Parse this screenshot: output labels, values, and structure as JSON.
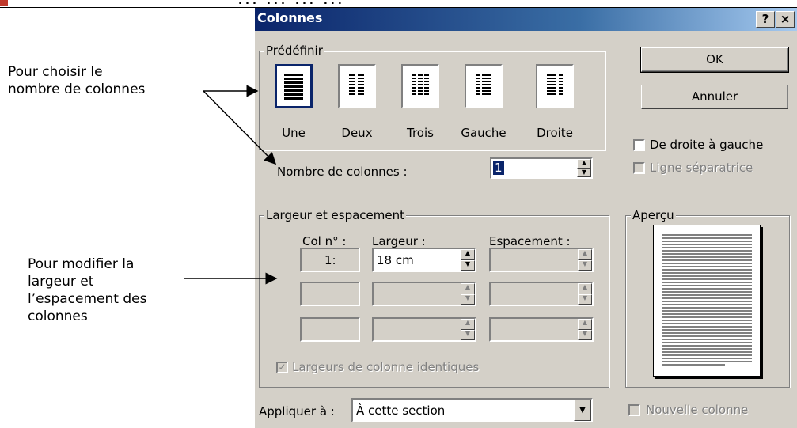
{
  "page_header_fragment": "... ... ... ...",
  "callouts": {
    "top": [
      "Pour choisir le",
      "nombre de colonnes"
    ],
    "bottom": [
      "Pour modifier la",
      "largeur et",
      "l’espacement des",
      "colonnes"
    ]
  },
  "dialog": {
    "title": "Colonnes",
    "help_button": "?",
    "close_button": "×",
    "predefinir": {
      "group_label": "Prédéfinir",
      "presets": [
        {
          "label": "Une",
          "mnemonic": "U",
          "selected": true
        },
        {
          "label": "Deux",
          "mnemonic": "x",
          "selected": false
        },
        {
          "label": "Trois",
          "mnemonic": "T",
          "selected": false
        },
        {
          "label": "Gauche",
          "mnemonic": "G",
          "selected": false
        },
        {
          "label": "Droite",
          "mnemonic": "D",
          "selected": false
        }
      ]
    },
    "ok_label": "OK",
    "cancel_label": "Annuler",
    "rtl_label": "De droite à gauche",
    "separator_label": "Ligne séparatrice",
    "nombre_label": "Nombre de colonnes :",
    "nombre_value": "1",
    "largeur": {
      "group_label": "Largeur et espacement",
      "col_header": "Col n° :",
      "width_header": "Largeur :",
      "spacing_header": "Espacement :",
      "rows": [
        {
          "col": "1:",
          "width": "18 cm",
          "spacing": ""
        },
        {
          "col": "",
          "width": "",
          "spacing": ""
        },
        {
          "col": "",
          "width": "",
          "spacing": ""
        }
      ],
      "identical_label": "Largeurs de colonne identiques"
    },
    "apercu_label": "Aperçu",
    "apply_label": "Appliquer à :",
    "apply_value": "À cette section",
    "new_column_label": "Nouvelle colonne"
  }
}
